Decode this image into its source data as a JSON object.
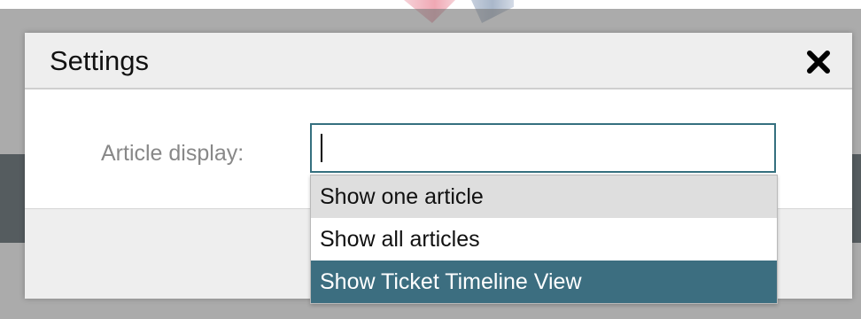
{
  "dialog": {
    "title": "Settings",
    "close_label": "×"
  },
  "article_display": {
    "label": "Article display:",
    "value": ""
  },
  "dropdown": {
    "options": [
      {
        "label": "Show one article",
        "state": "hover"
      },
      {
        "label": "Show all articles",
        "state": "normal"
      },
      {
        "label": "Show Ticket Timeline View",
        "state": "selected"
      }
    ]
  },
  "colors": {
    "accent": "#3c6e80",
    "input_border": "#35707f",
    "hover_bg": "#dedede",
    "header_bg": "#eeeeee"
  },
  "icons": {
    "close": "close-icon",
    "caret": "text-caret"
  }
}
